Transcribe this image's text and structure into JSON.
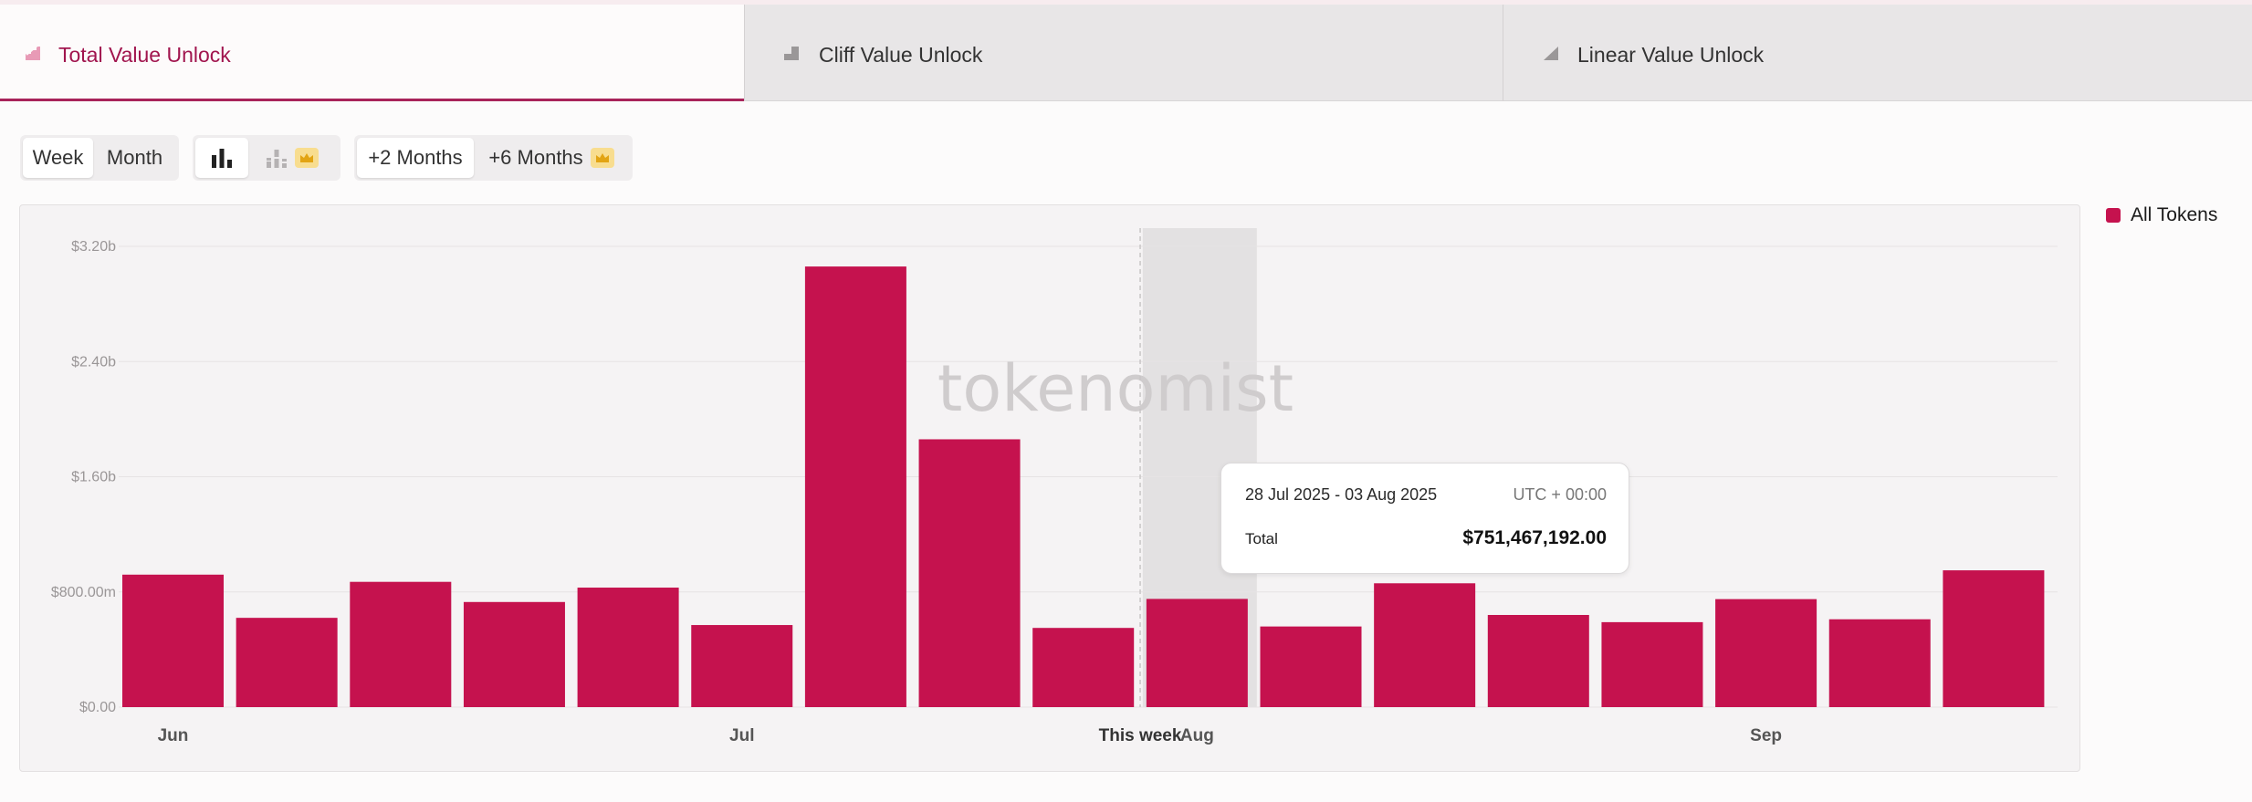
{
  "tabs": [
    {
      "label": "Total Value Unlock",
      "icon": "total-unlock-icon",
      "active": true
    },
    {
      "label": "Cliff Value Unlock",
      "icon": "cliff-unlock-icon",
      "active": false
    },
    {
      "label": "Linear Value Unlock",
      "icon": "linear-unlock-icon",
      "active": false
    }
  ],
  "controls": {
    "granularity": {
      "week": "Week",
      "month": "Month",
      "selected": "Week"
    },
    "chart_style": {
      "bar_icon": "bar-chart-icon",
      "stacked_icon": "stacked-chart-icon",
      "premium_icon": "crown-icon"
    },
    "range": {
      "two_months": "+2 Months",
      "six_months": "+6 Months",
      "selected": "+2 Months",
      "premium_icon": "crown-icon"
    }
  },
  "legend": {
    "label": "All Tokens",
    "color": "#c5124e"
  },
  "watermark": "tokenomist",
  "tooltip": {
    "range": "28 Jul 2025 - 03 Aug 2025",
    "timezone": "UTC + 00:00",
    "label": "Total",
    "value": "$751,467,192.00"
  },
  "colors": {
    "accent": "#a1154e",
    "bar": "#c5124e"
  },
  "chart_data": {
    "type": "bar",
    "title": "",
    "xlabel": "",
    "ylabel": "",
    "ylim": [
      0,
      3200000000
    ],
    "y_ticks": [
      {
        "value": 0,
        "label": "$0.00"
      },
      {
        "value": 800000000,
        "label": "$800.00m"
      },
      {
        "value": 1600000000,
        "label": "$1.60b"
      },
      {
        "value": 2400000000,
        "label": "$2.40b"
      },
      {
        "value": 3200000000,
        "label": "$3.20b"
      }
    ],
    "x_labels": [
      {
        "index": 0,
        "label": "Jun"
      },
      {
        "index": 5,
        "label": "Jul"
      },
      {
        "index": 8.5,
        "label": "This week",
        "current": true
      },
      {
        "index": 9,
        "label": "Aug"
      },
      {
        "index": 14,
        "label": "Sep"
      }
    ],
    "current_week_index": 8.5,
    "highlighted_index": 9,
    "grid": true,
    "legend_position": "right",
    "series": [
      {
        "name": "All Tokens",
        "values": [
          920000000,
          620000000,
          870000000,
          730000000,
          830000000,
          570000000,
          3060000000,
          1860000000,
          550000000,
          751467192,
          560000000,
          860000000,
          640000000,
          590000000,
          750000000,
          610000000,
          950000000
        ]
      }
    ]
  }
}
